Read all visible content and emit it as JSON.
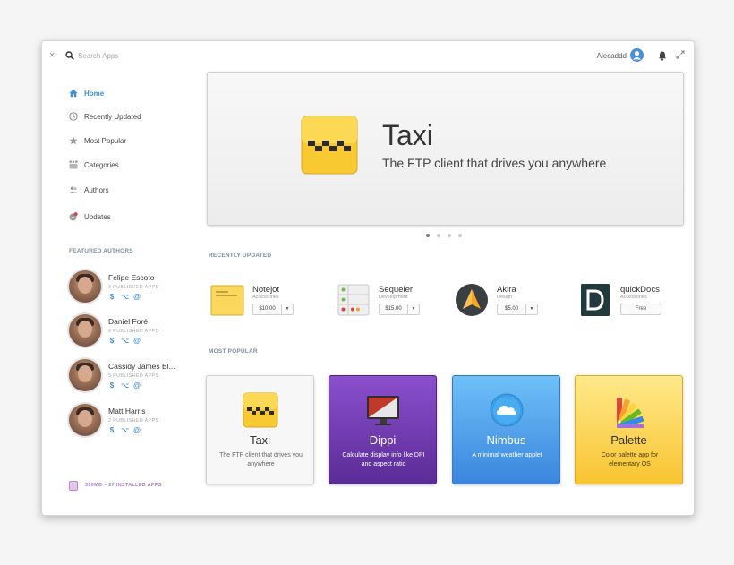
{
  "header": {
    "close_glyph": "×",
    "search_placeholder": "Search Apps",
    "username": "Alecaddd"
  },
  "sidebar": {
    "items": [
      {
        "label": "Home",
        "icon": "home-icon",
        "active": true
      },
      {
        "label": "Recently Updated",
        "icon": "clock-icon"
      },
      {
        "label": "Most Popular",
        "icon": "star-icon"
      },
      {
        "label": "Categories",
        "icon": "categories-icon"
      },
      {
        "label": "Authors",
        "icon": "authors-icon"
      },
      {
        "label": "Updates",
        "icon": "updates-icon",
        "badge": "2"
      }
    ],
    "featured_title": "FEATURED AUTHORS",
    "authors": [
      {
        "name": "Felipe Escoto",
        "apps": "3 PUBLISHED APPS"
      },
      {
        "name": "Daniel Foré",
        "apps": "6 PUBLISHED APPS"
      },
      {
        "name": "Cassidy James Bl...",
        "apps": "5 PUBLISHED APPS"
      },
      {
        "name": "Matt Harris",
        "apps": "2 PUBLISHED APPS"
      }
    ],
    "link_glyphs": {
      "donate": "$",
      "github": "⌥",
      "email": "@"
    },
    "installed": "350MB – 27 INSTALLED APPS"
  },
  "banner": {
    "title": "Taxi",
    "subtitle": "The FTP client that drives you anywhere",
    "slides": 4,
    "active_slide": 0
  },
  "recently_updated": {
    "title": "RECENTLY UPDATED",
    "apps": [
      {
        "name": "Notejot",
        "category": "Accessories",
        "price": "$10.00"
      },
      {
        "name": "Sequeler",
        "category": "Development",
        "price": "$15.00"
      },
      {
        "name": "Akira",
        "category": "Design",
        "price": "$5.00"
      },
      {
        "name": "quickDocs",
        "category": "Accessories",
        "price": "Free"
      }
    ]
  },
  "most_popular": {
    "title": "MOST POPULAR",
    "apps": [
      {
        "name": "Taxi",
        "desc": "The FTP client that drives you anywhere"
      },
      {
        "name": "Dippi",
        "desc": "Calculate display info like DPI and aspect ratio"
      },
      {
        "name": "Nimbus",
        "desc": "A minimal weather applet"
      },
      {
        "name": "Palette",
        "desc": "Color palette app for elementary OS"
      }
    ]
  },
  "colors": {
    "accent": "#3d8fd6",
    "taxi_yellow": "#f9c932",
    "dippi_purple": "#7a3fc2",
    "nimbus_blue": "#4ea3ec",
    "palette_yellow": "#fcd955"
  }
}
